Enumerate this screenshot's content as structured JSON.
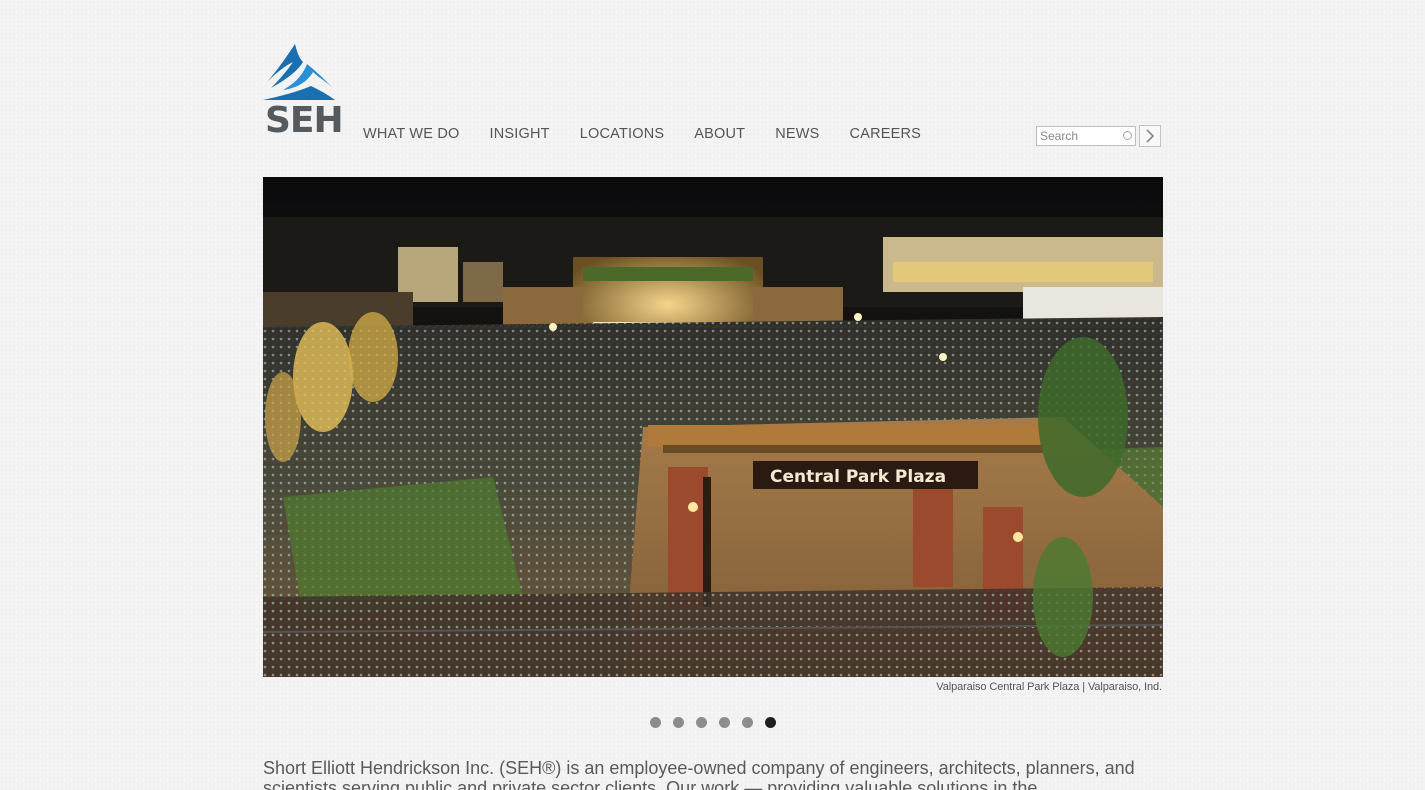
{
  "brand": {
    "logo_text": "SEH",
    "logo_colors": {
      "wave_dark": "#1a6fb0",
      "wave_light": "#2a8fd4",
      "text": "#555a5e"
    }
  },
  "nav": {
    "items": [
      {
        "label": "WHAT WE DO"
      },
      {
        "label": "INSIGHT"
      },
      {
        "label": "LOCATIONS"
      },
      {
        "label": "ABOUT"
      },
      {
        "label": "NEWS"
      },
      {
        "label": "CAREERS"
      }
    ]
  },
  "search": {
    "placeholder": "Search",
    "value": "",
    "go_icon": "chevron-right-icon",
    "clear_icon": "clear-circle-icon"
  },
  "hero": {
    "sign_text": "Central Park Plaza",
    "caption": "Valparaiso Central Park Plaza | Valparaiso, Ind."
  },
  "slider": {
    "dot_count": 6,
    "active_index": 5
  },
  "intro": {
    "text": "Short Elliott Hendrickson Inc. (SEH®) is an employee-owned company of engineers, architects, planners, and scientists serving public and private sector clients. Our work — providing valuable solutions in the"
  }
}
